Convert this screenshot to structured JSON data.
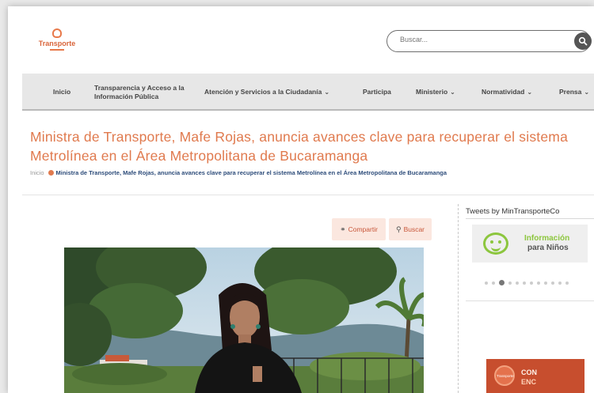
{
  "header": {
    "logo_text": "Transporte",
    "search_placeholder": "Buscar..."
  },
  "nav": {
    "items": [
      {
        "label": "Inicio"
      },
      {
        "label": "Transparencia y Acceso a la Información Pública"
      },
      {
        "label": "Atención y Servicios a la Ciudadanía"
      },
      {
        "label": "Participa"
      },
      {
        "label": "Ministerio"
      },
      {
        "label": "Normatividad"
      },
      {
        "label": "Prensa"
      }
    ]
  },
  "article": {
    "title": "Ministra de Transporte, Mafe Rojas, anuncia avances clave para recuperar el sistema Metrolínea en el Área Metropolitana de Bucaramanga",
    "breadcrumb_home": "Inicio",
    "breadcrumb_current": "Ministra de Transporte, Mafe Rojas, anuncia avances clave para recuperar el sistema Metrolínea en el Área Metropolitana de Bucaramanga",
    "share_label": "Compartir",
    "search_label": "Buscar"
  },
  "sidebar": {
    "tweets_title": "Tweets by MinTransporteCo",
    "kids_line1": "Información",
    "kids_line2": "para Niños",
    "banner_logo": "Transporte",
    "banner_line1": "CON",
    "banner_line2": "ENC"
  },
  "colors": {
    "accent": "#e07a4e",
    "kids_green": "#8cc63e",
    "nav_bg": "#e7e7e7"
  }
}
